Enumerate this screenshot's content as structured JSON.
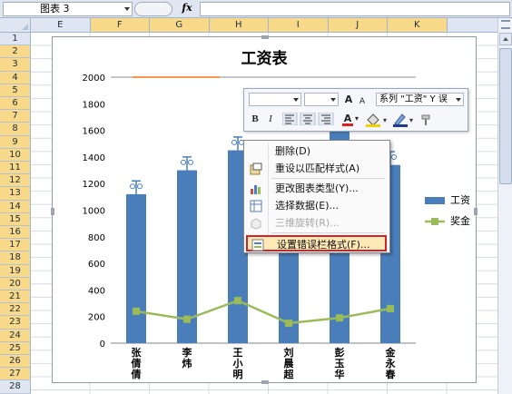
{
  "formula_bar": {
    "name_box": "图表 3",
    "pill_text": "",
    "fx_label": "fx",
    "formula": ""
  },
  "grid": {
    "columns": [
      "E",
      "F",
      "G",
      "H",
      "I",
      "J",
      "K"
    ],
    "selected_columns": [
      "F",
      "G",
      "H",
      "I",
      "J",
      "K"
    ],
    "rows": [
      "1",
      "2",
      "3",
      "4",
      "5",
      "6",
      "7",
      "8",
      "9",
      "10",
      "11",
      "12",
      "13",
      "14",
      "15",
      "16",
      "17",
      "18",
      "19",
      "20",
      "21",
      "22",
      "23",
      "24",
      "25",
      "26",
      "27",
      "28"
    ]
  },
  "mini_toolbar": {
    "font_size_up": "A",
    "font_size_down": "A",
    "series_select": "系列 \"工资\" Y 误",
    "bold": "B",
    "italic": "I",
    "font_color": "A"
  },
  "context_menu": {
    "items": [
      {
        "label": "删除(D)",
        "icon": "blank-icon",
        "enabled": true
      },
      {
        "label": "重设以匹配样式(A)",
        "icon": "reset-style-icon",
        "enabled": true
      },
      {
        "label": "更改图表类型(Y)...",
        "icon": "chart-type-icon",
        "enabled": true
      },
      {
        "label": "选择数据(E)...",
        "icon": "select-data-icon",
        "enabled": true
      },
      {
        "label": "三维旋转(R)...",
        "icon": "3d-rotate-icon",
        "enabled": false
      },
      {
        "label": "设置错误栏格式(F)...",
        "icon": "format-error-bar-icon",
        "enabled": true,
        "highlighted": true
      }
    ]
  },
  "chart_data": {
    "type": "bar",
    "title": "工资表",
    "categories": [
      "张倩倩",
      "李炜",
      "王小明",
      "刘晨超",
      "彭玉华",
      "金永春"
    ],
    "series": [
      {
        "name": "工资",
        "type": "bar",
        "color": "#4a7ebb",
        "values": [
          1120,
          1300,
          1450,
          1340,
          1630,
          1340
        ]
      },
      {
        "name": "奖金",
        "type": "line",
        "color": "#9bbb59",
        "values": [
          240,
          180,
          320,
          150,
          190,
          260
        ]
      }
    ],
    "error_bar_top_values": [
      1220,
      1400,
      1550,
      1360,
      1630,
      1440
    ],
    "ylim": [
      0,
      2000
    ],
    "yticks": [
      0,
      200,
      400,
      600,
      800,
      1000,
      1200,
      1400,
      1600,
      1800,
      2000
    ],
    "legend_position": "right",
    "max_line_color": "#f7964a",
    "grid": false
  }
}
